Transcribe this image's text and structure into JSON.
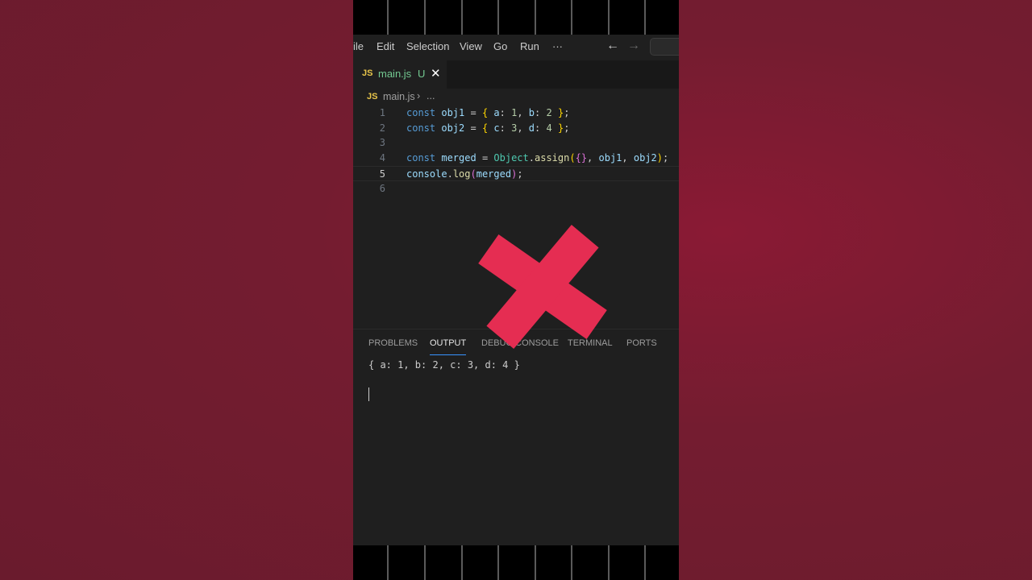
{
  "menu": {
    "items": [
      "ile",
      "Edit",
      "Selection",
      "View",
      "Go",
      "Run",
      "···"
    ],
    "back_arrow": "←",
    "forward_arrow": "→"
  },
  "tab": {
    "icon_label": "JS",
    "filename": "main.js",
    "status": "U",
    "close": "✕"
  },
  "breadcrumb": {
    "icon_label": "JS",
    "file": "main.js",
    "separator": "›",
    "more": "..."
  },
  "editor": {
    "current_line": 5,
    "lines": [
      {
        "num": "1",
        "tokens": [
          [
            "kw",
            "const "
          ],
          [
            "var",
            "obj1"
          ],
          [
            "pl",
            " = "
          ],
          [
            "br",
            "{"
          ],
          [
            "pl",
            " "
          ],
          [
            "var",
            "a"
          ],
          [
            "pl",
            ": "
          ],
          [
            "num",
            "1"
          ],
          [
            "pl",
            ", "
          ],
          [
            "var",
            "b"
          ],
          [
            "pl",
            ": "
          ],
          [
            "num",
            "2"
          ],
          [
            "pl",
            " "
          ],
          [
            "br",
            "}"
          ],
          [
            "pl",
            ";"
          ]
        ]
      },
      {
        "num": "2",
        "tokens": [
          [
            "kw",
            "const "
          ],
          [
            "var",
            "obj2"
          ],
          [
            "pl",
            " = "
          ],
          [
            "br",
            "{"
          ],
          [
            "pl",
            " "
          ],
          [
            "var",
            "c"
          ],
          [
            "pl",
            ": "
          ],
          [
            "num",
            "3"
          ],
          [
            "pl",
            ", "
          ],
          [
            "var",
            "d"
          ],
          [
            "pl",
            ": "
          ],
          [
            "num",
            "4"
          ],
          [
            "pl",
            " "
          ],
          [
            "br",
            "}"
          ],
          [
            "pl",
            ";"
          ]
        ]
      },
      {
        "num": "3",
        "tokens": []
      },
      {
        "num": "4",
        "tokens": [
          [
            "kw",
            "const "
          ],
          [
            "var",
            "merged"
          ],
          [
            "pl",
            " = "
          ],
          [
            "cls",
            "Object"
          ],
          [
            "pl",
            "."
          ],
          [
            "fn",
            "assign"
          ],
          [
            "br",
            "("
          ],
          [
            "br2",
            "{}"
          ],
          [
            "pl",
            ", "
          ],
          [
            "var",
            "obj1"
          ],
          [
            "pl",
            ", "
          ],
          [
            "var",
            "obj2"
          ],
          [
            "br",
            ")"
          ],
          [
            "pl",
            ";"
          ]
        ]
      },
      {
        "num": "5",
        "tokens": [
          [
            "var",
            "console"
          ],
          [
            "pl",
            "."
          ],
          [
            "fn",
            "log"
          ],
          [
            "br2",
            "("
          ],
          [
            "var",
            "merged"
          ],
          [
            "br2",
            ")"
          ],
          [
            "pl",
            ";"
          ]
        ]
      },
      {
        "num": "6",
        "tokens": []
      }
    ]
  },
  "panel": {
    "tabs": [
      "PROBLEMS",
      "OUTPUT",
      "DEBUG CONSOLE",
      "TERMINAL",
      "PORTS"
    ],
    "active_tab": "OUTPUT",
    "output_text": "{ a: 1, b: 2, c: 3, d: 4 }"
  },
  "overlay": {
    "icon": "red-x-mark-icon",
    "color": "#e52d52"
  },
  "colors": {
    "background": "#741c30",
    "editor_bg": "#1f1f1f",
    "accent": "#3794ff"
  }
}
